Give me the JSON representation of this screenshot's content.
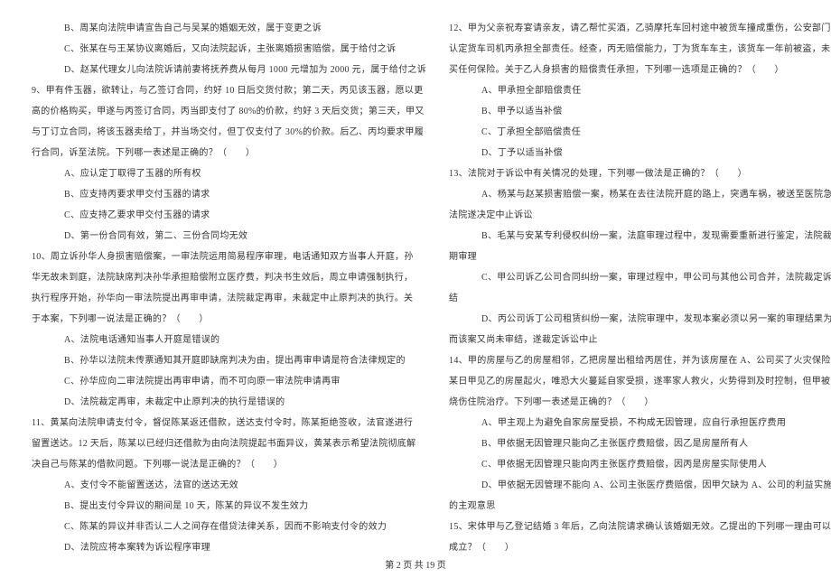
{
  "left_column": {
    "lines": [
      {
        "cls": "indent2",
        "text": "B、周某向法院申请宣告自己与吴某的婚姻无效，属于变更之诉"
      },
      {
        "cls": "indent2",
        "text": "C、张某在与王某协议离婚后，又向法院起诉，主张离婚损害赔偿，属于给付之诉"
      },
      {
        "cls": "indent2",
        "text": "D、赵某代理女儿向法院诉请前妻将抚养费从每月 1000 元增加为 2000 元，属于给付之诉"
      },
      {
        "cls": "",
        "text": "9、甲有件玉器，欲转让，与乙签订合同，约好 10 日后交货付款；第二天，丙见该玉器，愿以更"
      },
      {
        "cls": "",
        "text": "高的价格购买，甲遂与丙签订合同，丙当即支付了 80%的价款，约好 3 天后交货；第三天，甲又"
      },
      {
        "cls": "",
        "text": "与丁订立合同，将该玉器卖给丁，并当场交付，但丁仅支付了 30%的价款。后乙、丙均要求甲履"
      },
      {
        "cls": "",
        "text": "行合同，诉至法院。下列哪一表述是正确的？（　　）"
      },
      {
        "cls": "indent2",
        "text": "A、应认定丁取得了玉器的所有权"
      },
      {
        "cls": "indent2",
        "text": "B、应支持丙要求甲交付玉器的请求"
      },
      {
        "cls": "indent2",
        "text": "C、应支持乙要求甲交付玉器的请求"
      },
      {
        "cls": "indent2",
        "text": "D、第一份合同有效，第二、三份合同均无效"
      },
      {
        "cls": "",
        "text": "10、周立诉孙华人身损害赔偿案，一审法院运用简易程序审理，电话通知双方当事人开庭，孙"
      },
      {
        "cls": "",
        "text": "华无故未到庭，法院缺席判决孙华承担赔偿附立医疗费，判决书生效后，周立申请强制执行，"
      },
      {
        "cls": "",
        "text": "执行程序开始，孙华向一审法院提出再审申请，法院裁定再审，未裁定中止原判决的执行。关"
      },
      {
        "cls": "",
        "text": "于本案，下列哪一说法是正确的？（　　）"
      },
      {
        "cls": "indent2",
        "text": "A、法院电话通知当事人开庭是错误的"
      },
      {
        "cls": "indent2",
        "text": "B、孙华以法院未传票通知其开庭即缺席判决为由，提出再审申请是符合法律规定的"
      },
      {
        "cls": "indent2",
        "text": "C、孙华应向二审法院提出再审申请，而不可向原一审法院申请再审"
      },
      {
        "cls": "indent2",
        "text": "D、法院裁定再审，未裁定中止原判决的执行是错误的"
      },
      {
        "cls": "",
        "text": "11、黄某向法院申请支付令，督促陈某返还借款，送达支付令时，陈某拒绝签收，法官遂进行"
      },
      {
        "cls": "",
        "text": "留置送达。12 天后，陈某以已经归还借款为由向法院提起书面异议，黄某表示希望法院彻底解"
      },
      {
        "cls": "",
        "text": "决自己与陈某的借款问题。下列哪一说法是正确的？（　　）"
      },
      {
        "cls": "indent2",
        "text": "A、支付令不能留置送达，法官的送达无效"
      },
      {
        "cls": "indent2",
        "text": "B、提出支付令异议的期间是 10 天，陈某的异议不发生效力"
      },
      {
        "cls": "indent2",
        "text": "C、陈某的异议并非否认二人之间存在借贷法律关系，因而不影响支付令的效力"
      },
      {
        "cls": "indent2",
        "text": "D、法院应将本案转为诉讼程序审理"
      }
    ]
  },
  "right_column": {
    "lines": [
      {
        "cls": "",
        "text": "12、甲为父亲祝寿宴请亲友，请乙帮忙买酒，乙骑摩托车回村途中被货车撞成重伤，公安部门"
      },
      {
        "cls": "",
        "text": "认定货车司机丙承担全部责任。经查，丙无赔偿能力，丁为货车车主，该货车一年前被盗，未"
      },
      {
        "cls": "",
        "text": "买任何保险。关于乙人身损害的赔偿责任承担，下列哪一选项是正确的？（　　）"
      },
      {
        "cls": "indent2",
        "text": "A、甲承担全部赔偿责任"
      },
      {
        "cls": "indent2",
        "text": "B、甲予以适当补偿"
      },
      {
        "cls": "indent2",
        "text": "C、丁承担全部赔偿责任"
      },
      {
        "cls": "indent2",
        "text": "D、丁予以适当补偿"
      },
      {
        "cls": "",
        "text": "13、法院对于诉讼中有关情况的处理，下列哪一做法是正确的？（　　）"
      },
      {
        "cls": "indent2",
        "text": "A、杨某与赵某损害赔偿一案，杨某在去往法院开庭的路上，突遇车祸，被送至医院急救，"
      },
      {
        "cls": "",
        "text": "法院遂决定中止诉讼"
      },
      {
        "cls": "indent2",
        "text": "B、毛某与安某专利侵权纠纷一案，法庭审理过程中，发现需要重新进行鉴定，法院裁定延"
      },
      {
        "cls": "",
        "text": "期审理"
      },
      {
        "cls": "indent2",
        "text": "C、甲公司诉乙公司合同纠纷一案，审理过程中，甲公司与其他公司合并，法院裁定诉讼终"
      },
      {
        "cls": "",
        "text": "结"
      },
      {
        "cls": "indent2",
        "text": "D、丙公司诉丁公司租赁纠纷一案，法院审理中，发现本案必须以另一案的审理结果为依据，"
      },
      {
        "cls": "",
        "text": "而该案又尚未审结，遂裁定诉讼中止"
      },
      {
        "cls": "",
        "text": "14、甲的房屋与乙的房屋相邻，乙把房屋出租给丙居住，并为该房屋在 A、公司买了火灾保险。"
      },
      {
        "cls": "",
        "text": "某日甲见乙的房屋起火，唯恐大火蔓延自家受损，遂率家人救火，火势得到及时控制，但甲被"
      },
      {
        "cls": "",
        "text": "烧伤住院治疗。下列哪一表述是正确的？（　　）"
      },
      {
        "cls": "indent2",
        "text": "A、甲主观上为避免自家房屋受损，不构成无因管理，应自行承担医疗费用"
      },
      {
        "cls": "indent2",
        "text": "B、甲依据无因管理只能向乙主张医疗费赔偿，因乙是房屋所有人"
      },
      {
        "cls": "indent2",
        "text": "C、甲依据无因管理只能向丙主张医疗费赔偿，因丙是房屋实际使用人"
      },
      {
        "cls": "indent2",
        "text": "D、甲依据无因管理不能向 A、公司主张医疗费赔偿，因甲欠缺为 A、公司的利益实施管理"
      },
      {
        "cls": "",
        "text": "的主观意思"
      },
      {
        "cls": "",
        "text": "15、宋体甲与乙登记结婚 3 年后，乙向法院请求确认该婚姻无效。乙提出的下列哪一理由可以"
      },
      {
        "cls": "",
        "text": "成立？（　　）"
      }
    ]
  },
  "footer": "第 2 页 共 19 页"
}
